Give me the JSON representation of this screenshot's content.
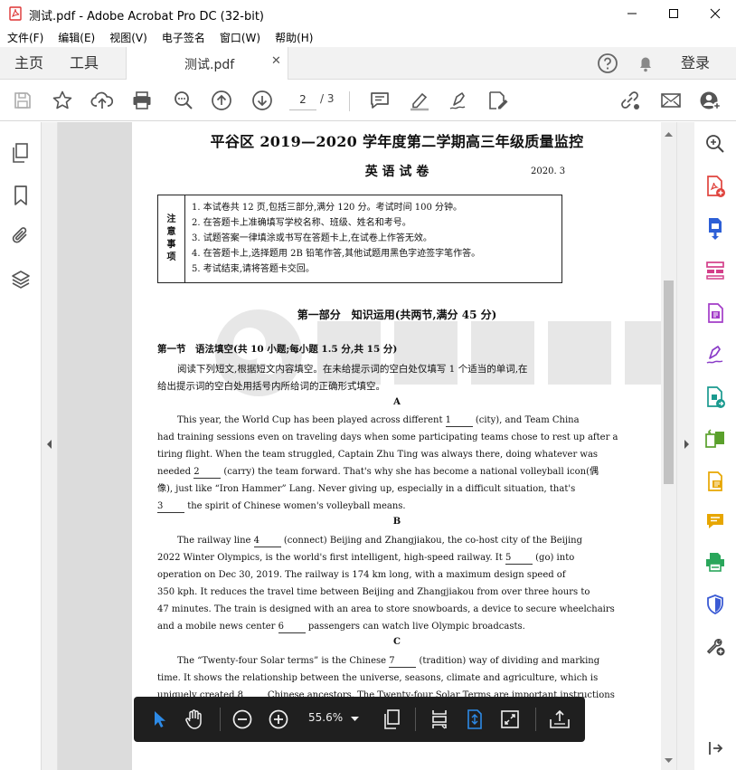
{
  "window": {
    "title": "测试.pdf - Adobe Acrobat Pro DC (32-bit)"
  },
  "menu": [
    "文件(F)",
    "编辑(E)",
    "视图(V)",
    "电子签名",
    "窗口(W)",
    "帮助(H)"
  ],
  "tabs": {
    "home": "主页",
    "tools": "工具",
    "document": "测试.pdf",
    "login": "登录"
  },
  "toolbar": {
    "page_current": "2",
    "page_total": "/ 3"
  },
  "floatbar": {
    "zoom": "55.6%"
  },
  "doc": {
    "title": "平谷区 2019—2020 学年度第二学期高三年级质量监控",
    "subtitle": "英 语 试 卷",
    "date": "2020. 3",
    "notice_label": [
      "注",
      "意",
      "事",
      "项"
    ],
    "notice_items": [
      "1. 本试卷共 12 页,包括三部分,满分 120 分。考试时间 100 分钟。",
      "2. 在答题卡上准确填写学校名称、班级、姓名和考号。",
      "3. 试题答案一律填涂或书写在答题卡上,在试卷上作答无效。",
      "4. 在答题卡上,选择题用 2B 铅笔作答,其他试题用黑色字迹签字笔作答。",
      "5. 考试结束,请将答题卡交回。"
    ],
    "part1": "第一部分　知识运用(共两节,满分 45 分)",
    "section1": "第一节　语法填空(共 10 小题;每小题 1.5 分,共 15 分)",
    "instr": [
      "阅读下列短文,根据短文内容填空。在未给提示词的空白处仅填写 1 个适当的单词,在",
      "给出提示词的空白处用括号内所给词的正确形式填空。"
    ],
    "labelA": "A",
    "labelB": "B",
    "labelC": "C",
    "blanks": [
      "1",
      "2",
      "3",
      "4",
      "5",
      "6",
      "7",
      "8"
    ],
    "A": [
      [
        "This year, the World Cup has been played across different",
        "(city), and Team China"
      ],
      [
        "had training sessions even on traveling days when some participating teams chose to rest up after a"
      ],
      [
        "tiring flight. When the team struggled, Captain Zhu Ting was always there, doing whatever was"
      ],
      [
        "needed",
        "(carry) the team forward. That's why she has become a national volleyball icon(偶"
      ],
      [
        "像), just like “Iron Hammer” Lang. Never giving up, especially in a difficult situation, that's"
      ],
      [
        "the spirit of Chinese women's volleyball means."
      ]
    ],
    "B": [
      [
        "The railway line",
        "(connect) Beijing and Zhangjiakou, the co-host city of the Beijing"
      ],
      [
        "2022 Winter Olympics, is the world's first intelligent, high-speed railway. It",
        "(go) into"
      ],
      [
        "operation on Dec 30, 2019. The railway is 174 km long, with a maximum design speed of"
      ],
      [
        "350 kph. It reduces the travel time between Beijing and Zhangjiakou from over three hours to"
      ],
      [
        "47 minutes. The train is designed with an area to store snowboards, a device to secure wheelchairs"
      ],
      [
        "and a mobile news center",
        "passengers can watch live Olympic broadcasts."
      ]
    ],
    "C": [
      [
        "The “Twenty-four Solar terms” is the Chinese",
        "(tradition) way of dividing and marking"
      ],
      [
        "time. It shows the relationship between the universe, seasons, climate and agriculture, which is"
      ],
      [
        "uniquely created",
        "Chinese ancestors. The Twenty-four Solar Terms are important instructions"
      ]
    ]
  },
  "colors": {
    "accent_blue": "#2d8ae6",
    "pdf_red": "#e0443e",
    "floatbar_bg": "#1f1f1f"
  }
}
